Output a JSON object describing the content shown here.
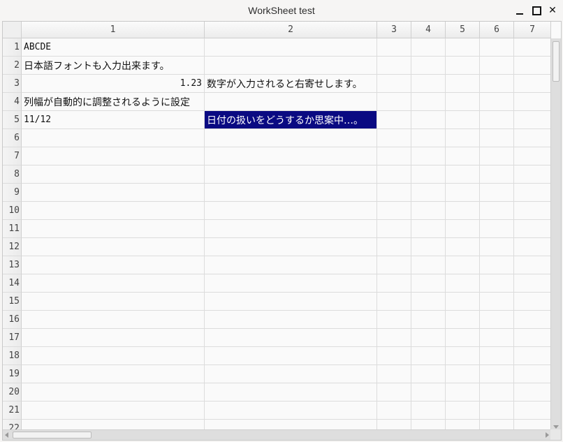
{
  "window": {
    "title": "WorkSheet test",
    "minimize_icon": "minimize-icon",
    "maximize_icon": "maximize-icon",
    "close_label": "✕"
  },
  "columns": [
    "1",
    "2",
    "3",
    "4",
    "5",
    "6",
    "7"
  ],
  "rows": [
    "1",
    "2",
    "3",
    "4",
    "5",
    "6",
    "7",
    "8",
    "9",
    "10",
    "11",
    "12",
    "13",
    "14",
    "15",
    "16",
    "17",
    "18",
    "19",
    "20",
    "21",
    "22"
  ],
  "cells": {
    "r1c1": "ABCDE",
    "r2c1": "日本語フォントも入力出来ます。",
    "r3c1": "1.23",
    "r3c2": "数字が入力されると右寄せします。",
    "r4c1": "列幅が自動的に調整されるように設定",
    "r5c1": "11/12",
    "r5c2": "日付の扱いをどうするか思案中…。"
  },
  "selection": {
    "row": "5",
    "column": "2",
    "highlight_color": "#0a0a82"
  },
  "scrollbars": {
    "vertical": "vertical-scrollbar",
    "horizontal": "horizontal-scrollbar"
  }
}
